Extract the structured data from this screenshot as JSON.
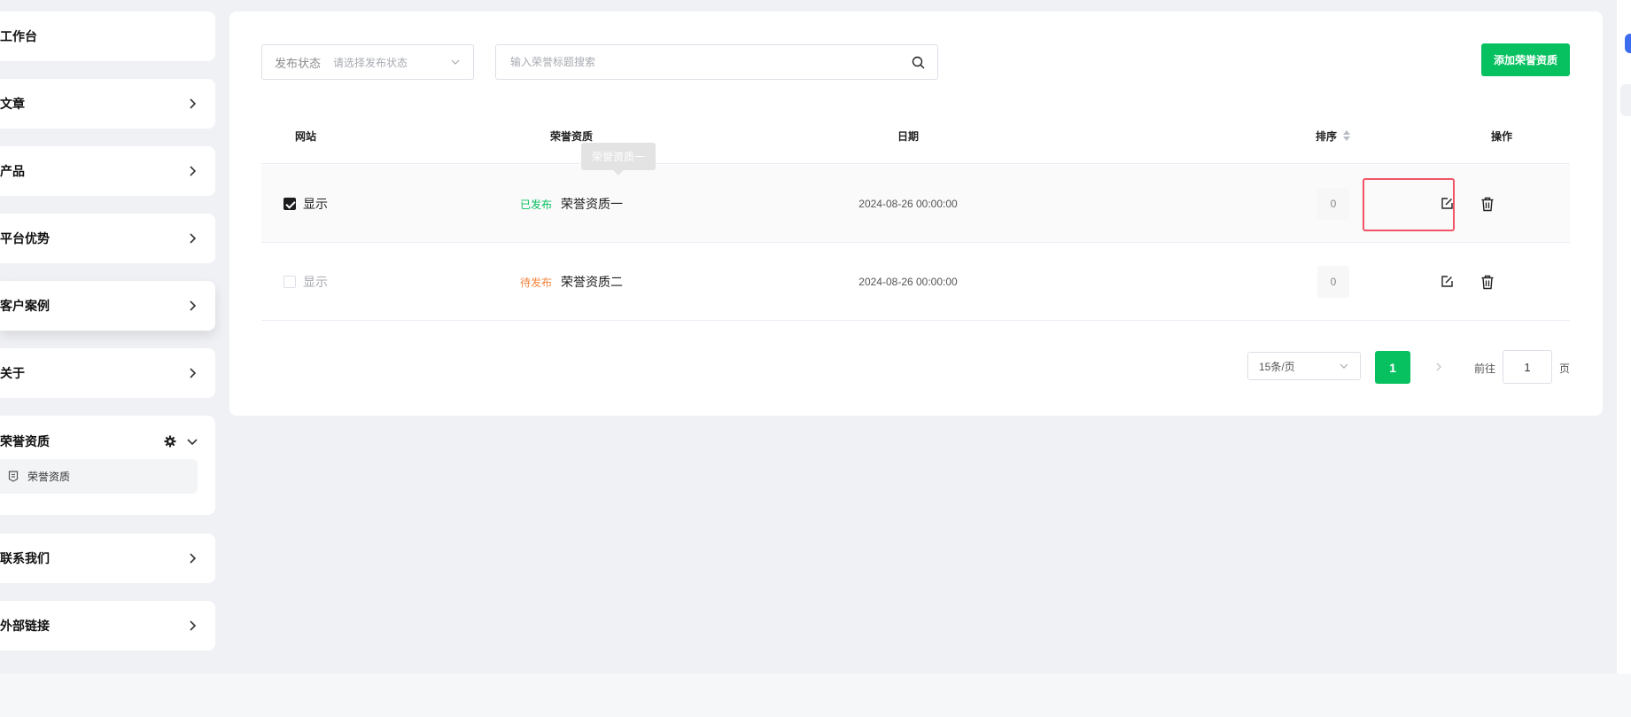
{
  "sidebar": {
    "items": [
      {
        "label": "工作台"
      },
      {
        "label": "文章"
      },
      {
        "label": "产品"
      },
      {
        "label": "平台优势"
      },
      {
        "label": "客户案例"
      },
      {
        "label": "关于"
      },
      {
        "label": "荣誉资质",
        "expanded": true,
        "children": [
          {
            "label": "荣誉资质"
          }
        ]
      },
      {
        "label": "联系我们"
      },
      {
        "label": "外部链接"
      }
    ]
  },
  "toolbar": {
    "filter_label": "发布状态",
    "filter_placeholder": "请选择发布状态",
    "search_placeholder": "输入荣誉标题搜索",
    "add_label": "添加荣誉资质"
  },
  "table": {
    "columns": [
      "网站",
      "荣誉资质",
      "日期",
      "排序",
      "操作"
    ],
    "rows": [
      {
        "checked": true,
        "site": "显示",
        "status": "已发布",
        "status_color": "#07c160",
        "title": "荣誉资质一",
        "date": "2024-08-26 00:00:00",
        "sort": "0"
      },
      {
        "checked": false,
        "site": "显示",
        "status": "待发布",
        "status_color": "#f5833b",
        "title": "荣誉资质二",
        "date": "2024-08-26 00:00:00",
        "sort": "0"
      }
    ],
    "tooltip": "荣誉资质一"
  },
  "pagination": {
    "page_size": "15条/页",
    "current_page": "1",
    "goto_label": "前往",
    "goto_value": "1",
    "page_unit": "页"
  },
  "colors": {
    "accent": "#07c160",
    "pending": "#f5833b",
    "highlight": "#f25466"
  }
}
